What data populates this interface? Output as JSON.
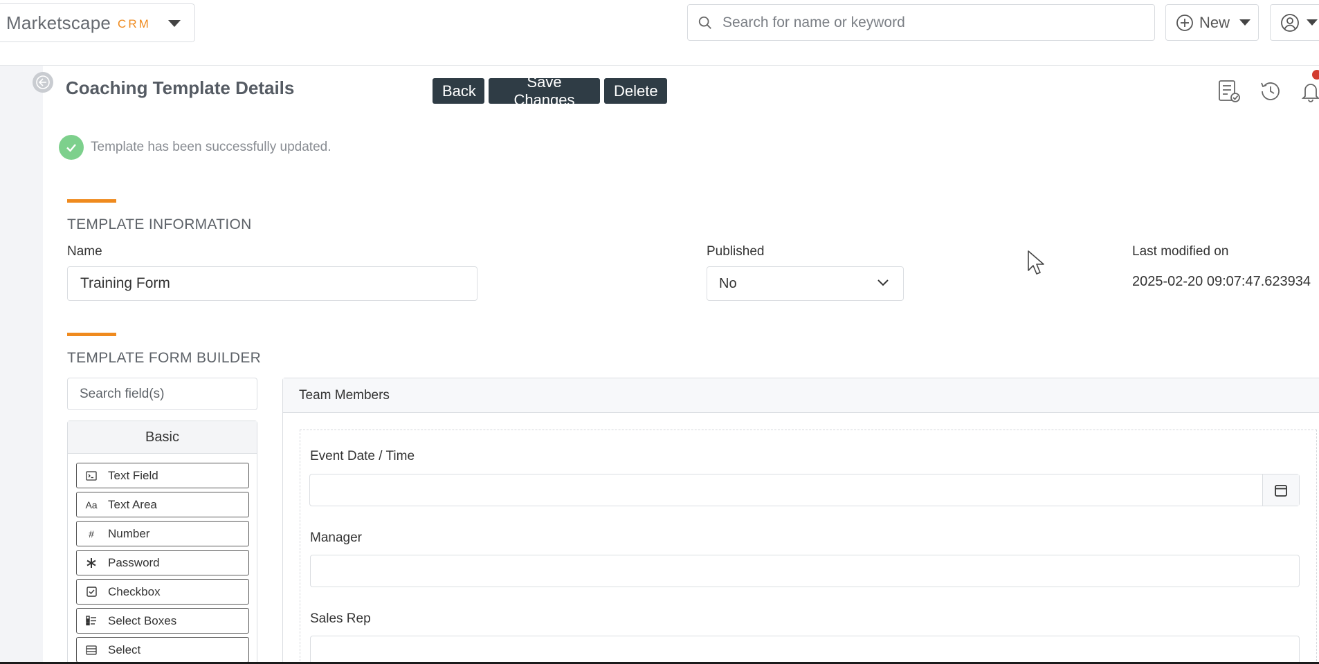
{
  "app": {
    "brand_name": "Marketscape",
    "brand_sub": "CRM"
  },
  "header": {
    "search_placeholder": "Search for name or keyword",
    "new_label": "New"
  },
  "page": {
    "title": "Coaching Template Details",
    "actions": {
      "back": "Back",
      "save": "Save Changes",
      "delete": "Delete"
    },
    "alert": "Template has been successfully updated."
  },
  "template_info": {
    "section_title": "TEMPLATE INFORMATION",
    "name_label": "Name",
    "name_value": "Training Form",
    "published_label": "Published",
    "published_value": "No",
    "modified_label": "Last modified on",
    "modified_value": "2025-02-20 09:07:47.623934"
  },
  "form_builder": {
    "section_title": "TEMPLATE FORM BUILDER",
    "search_placeholder": "Search field(s)",
    "palette_group": "Basic",
    "palette_items": [
      {
        "label": "Text Field",
        "icon": "terminal-icon"
      },
      {
        "label": "Text Area",
        "icon": "font-icon"
      },
      {
        "label": "Number",
        "icon": "hashtag-icon"
      },
      {
        "label": "Password",
        "icon": "asterisk-icon"
      },
      {
        "label": "Checkbox",
        "icon": "check-square-icon"
      },
      {
        "label": "Select Boxes",
        "icon": "list-check-icon"
      },
      {
        "label": "Select",
        "icon": "list-icon"
      }
    ],
    "panel_title": "Team Members",
    "fields": [
      {
        "label": "Event Date / Time"
      },
      {
        "label": "Manager"
      },
      {
        "label": "Sales Rep"
      }
    ]
  },
  "colors": {
    "accent": "#ef8a1e",
    "dark_button": "#2f3c45",
    "success": "#7dd08c",
    "notification": "#d23b2f"
  }
}
